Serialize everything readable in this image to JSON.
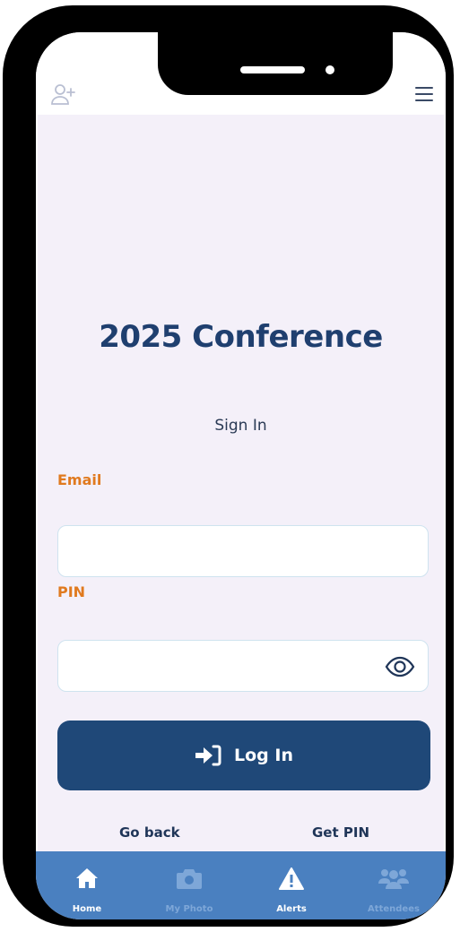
{
  "header": {
    "add_user_icon": "add-user-icon",
    "menu_icon": "hamburger-menu-icon"
  },
  "main": {
    "title": "2025 Conference",
    "subtitle": "Sign In",
    "email": {
      "label": "Email",
      "value": ""
    },
    "pin": {
      "label": "PIN",
      "value": "",
      "toggle_icon": "eye-icon"
    },
    "login_button": {
      "label": "Log In",
      "icon": "login-arrow-icon"
    },
    "links": {
      "back": "Go back",
      "get_pin": "Get PIN"
    }
  },
  "tabbar": {
    "items": [
      {
        "label": "Home",
        "icon": "home-icon",
        "active": true
      },
      {
        "label": "My Photo",
        "icon": "camera-icon",
        "active": false
      },
      {
        "label": "Alerts",
        "icon": "warning-icon",
        "active": true
      },
      {
        "label": "Attendees",
        "icon": "people-icon",
        "active": false
      }
    ]
  },
  "colors": {
    "primary": "#1f4878",
    "accent": "#e07a1f",
    "background": "#f4f0f9",
    "tabbar": "#4a80c0"
  }
}
